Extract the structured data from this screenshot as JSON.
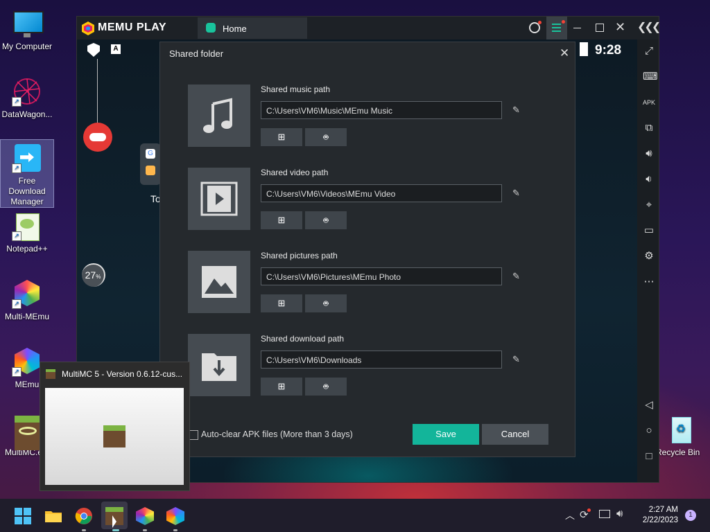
{
  "desktop": {
    "icons": [
      {
        "label": "My Computer"
      },
      {
        "label": "DataWagon..."
      },
      {
        "label": "Free Download Manager"
      },
      {
        "label": "Notepad++"
      },
      {
        "label": "Multi-MEmu"
      },
      {
        "label": "MEmu"
      },
      {
        "label": "MultiMC.e..."
      },
      {
        "label": "Recycle Bin"
      }
    ]
  },
  "memu": {
    "logo": "MEMU PLAY",
    "tab_label": "Home",
    "time": "9:28",
    "cpu_percent": "27",
    "percent_sign": "%",
    "left_badge": "A",
    "home_partial": "To"
  },
  "dialog": {
    "title": "Shared folder",
    "rows": [
      {
        "label": "Shared music path",
        "value": "C:\\Users\\VM6\\Music\\MEmu Music",
        "icon": "music-icon"
      },
      {
        "label": "Shared video path",
        "value": "C:\\Users\\VM6\\Videos\\MEmu Video",
        "icon": "video-icon"
      },
      {
        "label": "Shared pictures path",
        "value": "C:\\Users\\VM6\\Pictures\\MEmu Photo",
        "icon": "picture-icon"
      },
      {
        "label": "Shared download path",
        "value": "C:\\Users\\VM6\\Downloads",
        "icon": "download-folder-icon"
      }
    ],
    "auto_clear_label": "Auto-clear APK files (More than 3 days)",
    "save_label": "Save",
    "cancel_label": "Cancel",
    "colors": {
      "save": "#13b59a",
      "cancel": "#4a5056"
    }
  },
  "preview": {
    "title": "MultiMC 5 - Version 0.6.12-cus..."
  },
  "taskbar": {
    "time": "2:27 AM",
    "date": "2/22/2023",
    "notification_count": "1"
  }
}
